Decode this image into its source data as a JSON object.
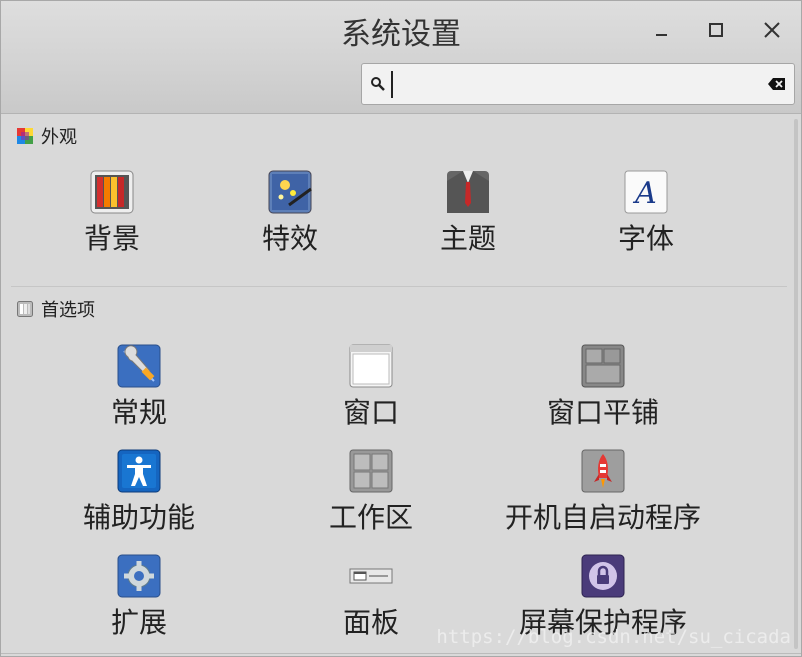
{
  "window": {
    "title": "系统设置"
  },
  "search": {
    "value": "",
    "placeholder": ""
  },
  "sections": [
    {
      "title": "外观",
      "icon": "appearance-icon",
      "items": [
        {
          "label": "背景",
          "icon": "backgrounds-icon"
        },
        {
          "label": "特效",
          "icon": "effects-icon"
        },
        {
          "label": "主题",
          "icon": "themes-icon"
        },
        {
          "label": "字体",
          "icon": "fonts-icon"
        }
      ]
    },
    {
      "title": "首选项",
      "icon": "preferences-icon",
      "items": [
        {
          "label": "常规",
          "icon": "general-icon"
        },
        {
          "label": "窗口",
          "icon": "windows-icon"
        },
        {
          "label": "窗口平铺",
          "icon": "window-tiling-icon"
        },
        {
          "label": "辅助功能",
          "icon": "accessibility-icon"
        },
        {
          "label": "工作区",
          "icon": "workspaces-icon"
        },
        {
          "label": "开机自启动程序",
          "icon": "startup-applications-icon"
        },
        {
          "label": "扩展",
          "icon": "extensions-icon"
        },
        {
          "label": "面板",
          "icon": "panel-icon"
        },
        {
          "label": "屏幕保护程序",
          "icon": "screensaver-icon"
        }
      ]
    }
  ],
  "watermark": "https://blog.csdn.net/su_cicada"
}
